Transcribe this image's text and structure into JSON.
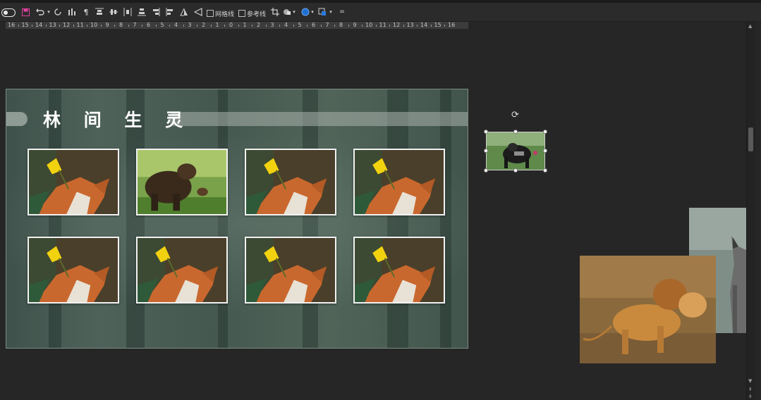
{
  "toolbar": {
    "gridlines_label": "网格线",
    "guides_label": "参考线",
    "more_label": "="
  },
  "ruler": {
    "labels": [
      "16",
      "15",
      "14",
      "13",
      "12",
      "11",
      "10",
      "9",
      "8",
      "7",
      "6",
      "5",
      "4",
      "3",
      "2",
      "1",
      "0",
      "1",
      "2",
      "3",
      "4",
      "5",
      "6",
      "7",
      "8",
      "9",
      "10",
      "11",
      "12",
      "13",
      "14",
      "15",
      "16"
    ]
  },
  "slide": {
    "title": "林 间 生 灵",
    "photos": [
      "fox",
      "bear",
      "fox",
      "fox",
      "fox",
      "fox",
      "fox",
      "fox"
    ]
  },
  "offslide": {
    "gorilla": "gorilla-photo",
    "lion": "lions-photo",
    "cat": "cat-photo"
  },
  "colors": {
    "slide_bg": "#4b5f57",
    "pill": "#a9b3ad",
    "workspace": "#262626",
    "selection_handle": "#ffffff"
  }
}
